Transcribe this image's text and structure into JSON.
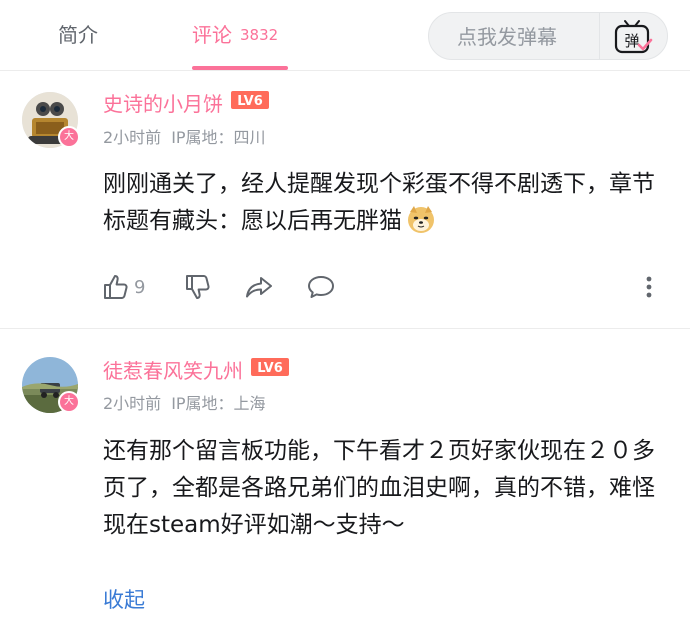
{
  "tabs": {
    "intro_label": "简介",
    "comments_label": "评论",
    "comments_count": "3832",
    "active_color": "#fb7299"
  },
  "danmaku": {
    "placeholder": "点我发弹幕",
    "button_glyph": "弹"
  },
  "comments": [
    {
      "username": "史诗的小月饼",
      "level": "LV6",
      "avatar_badge": "大",
      "time": "2小时前",
      "ip_label": "IP属地：四川",
      "text": "刚刚通关了，经人提醒发现个彩蛋不得不剧透下，章节标题有藏头：愿以后再无胖猫",
      "emoji": "doge-emoji",
      "likes": "9"
    },
    {
      "username": "徒惹春风笑九州",
      "level": "LV6",
      "avatar_badge": "大",
      "time": "2小时前",
      "ip_label": "IP属地：上海",
      "text": "还有那个留言板功能，下午看才２页好家伙现在２０多页了，全都是各路兄弟们的血泪史啊，真的不错，难怪现在steam好评如潮～支持～",
      "collapse_label": "收起"
    }
  ]
}
